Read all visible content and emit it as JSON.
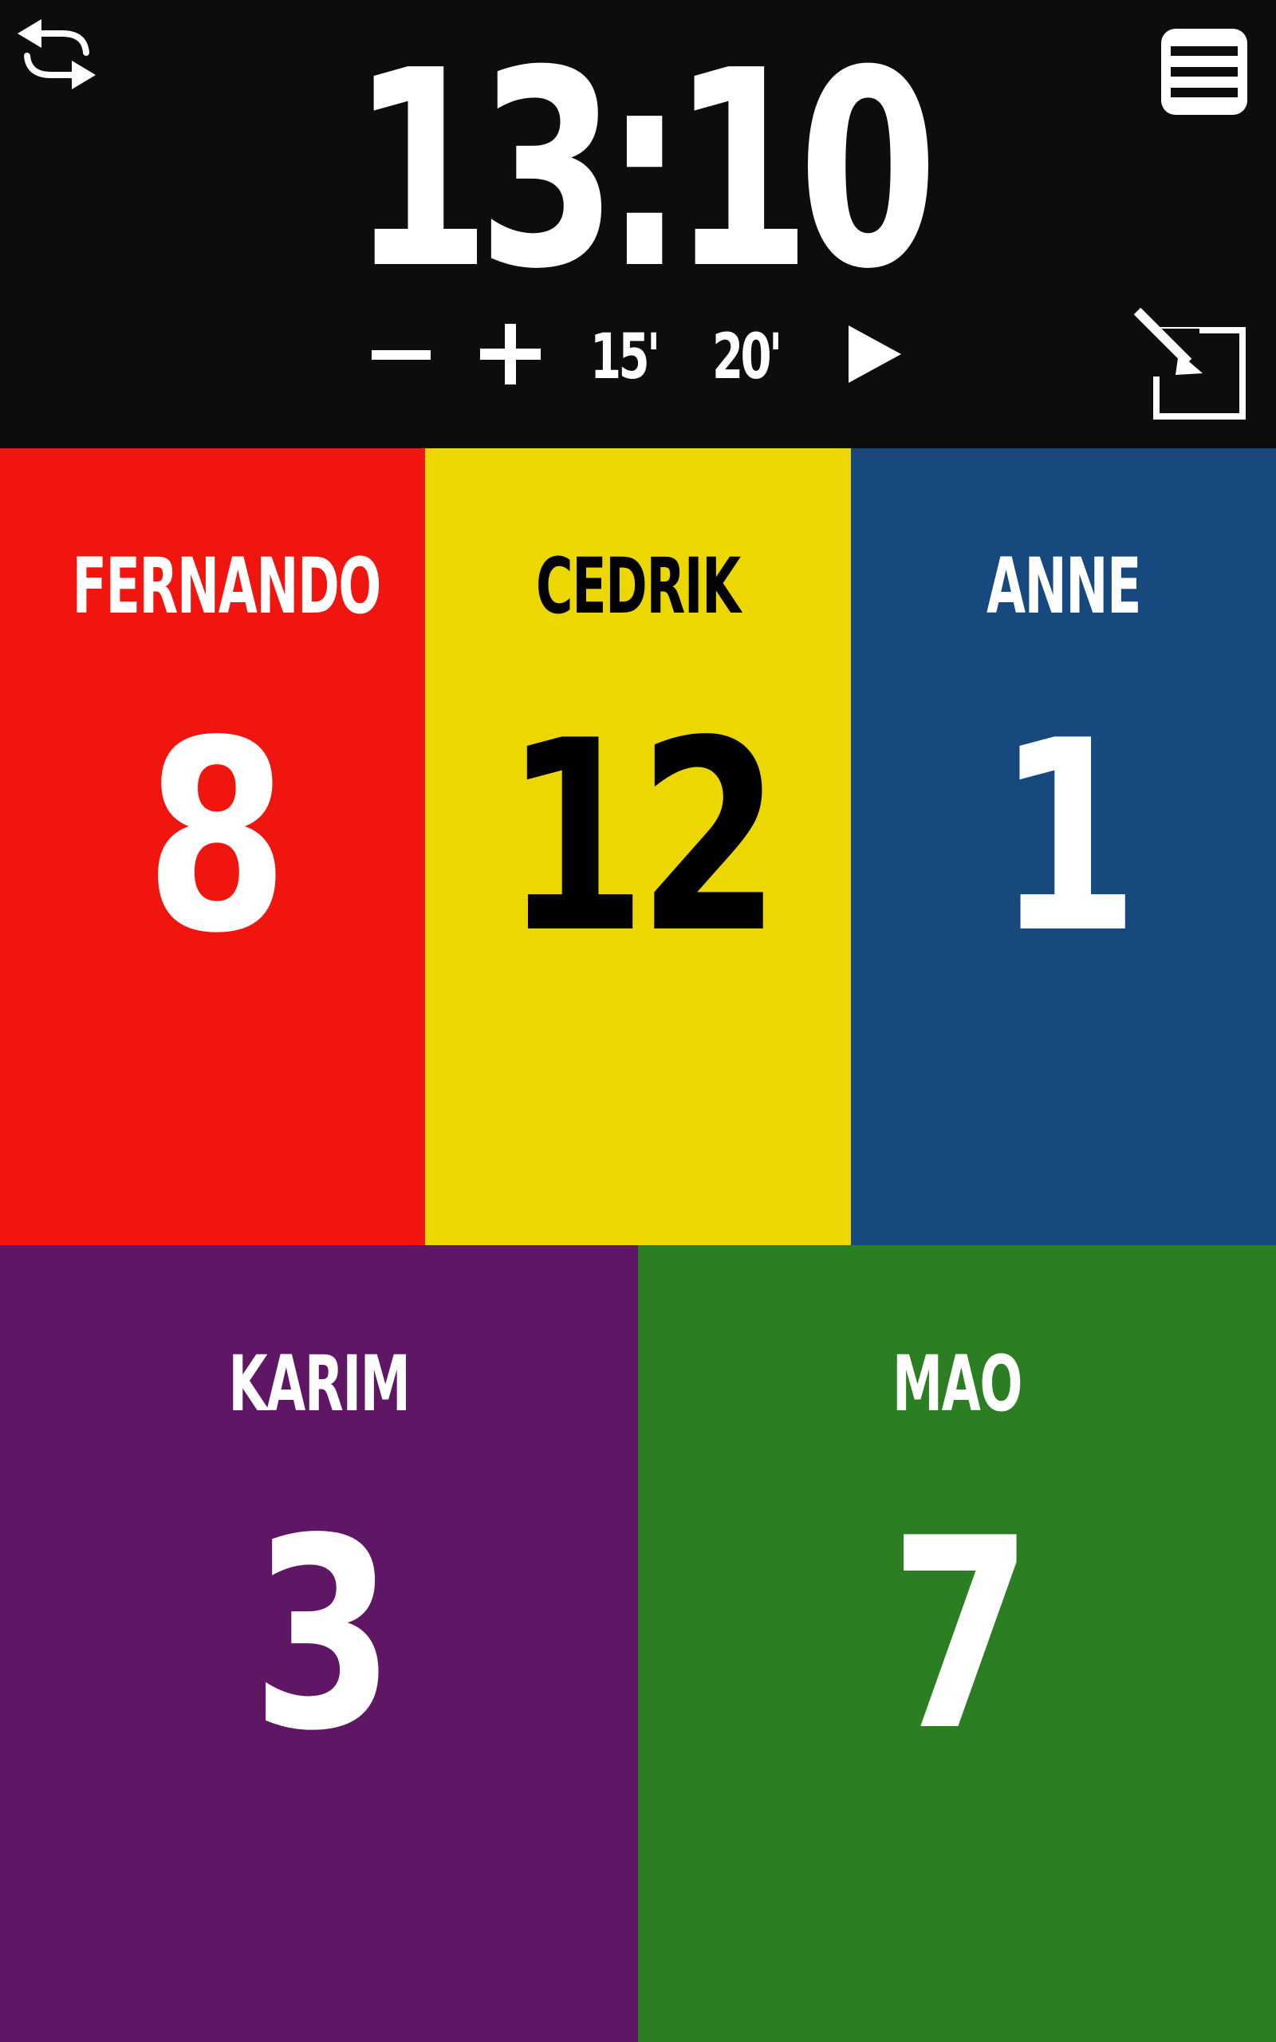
{
  "header": {
    "timer": "13:10",
    "controls": {
      "minus_icon": "minus-icon",
      "plus_icon": "plus-icon",
      "preset_15": "15'",
      "preset_20": "20'",
      "play_icon": "play-icon"
    },
    "icons": {
      "swap": "swap-arrows-icon",
      "menu": "menu-icon",
      "screen": "exit-fullscreen-icon"
    }
  },
  "players": [
    {
      "name": "FERNANDO",
      "score": "8",
      "color": "#f0150f",
      "text_color": "#ffffff"
    },
    {
      "name": "CEDRIK",
      "score": "12",
      "color": "#ecd800",
      "text_color": "#000000"
    },
    {
      "name": "ANNE",
      "score": "1",
      "color": "#17497e",
      "text_color": "#ffffff"
    },
    {
      "name": "KARIM",
      "score": "3",
      "color": "#5f1664",
      "text_color": "#ffffff"
    },
    {
      "name": "MAO",
      "score": "7",
      "color": "#2b7e22",
      "text_color": "#ffffff"
    }
  ],
  "colors": {
    "header_bg": "#0d0d0d",
    "icon": "#ffffff"
  }
}
